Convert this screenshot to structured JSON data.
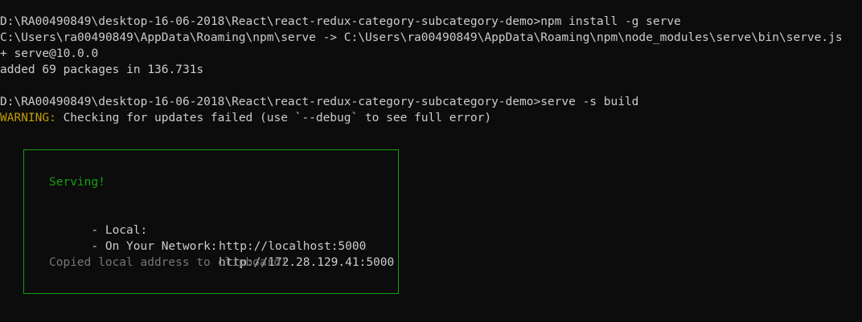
{
  "terminal": {
    "lines": [
      "D:\\RA00490849\\desktop-16-06-2018\\React\\react-redux-category-subcategory-demo>npm install -g serve",
      "C:\\Users\\ra00490849\\AppData\\Roaming\\npm\\serve -> C:\\Users\\ra00490849\\AppData\\Roaming\\npm\\node_modules\\serve\\bin\\serve.js",
      "+ serve@10.0.0",
      "added 69 packages in 136.731s",
      "D:\\RA00490849\\desktop-16-06-2018\\React\\react-redux-category-subcategory-demo>serve -s build"
    ],
    "warning_label": "WARNING:",
    "warning_text": " Checking for updates failed (use `--debug` to see full error)"
  },
  "serve_box": {
    "title": "Serving!",
    "local_label": "- Local:",
    "local_url": "http://localhost:5000",
    "network_label": "- On Your Network:",
    "network_url": "http://172.28.129.41:5000",
    "copied_text": "Copied local address to clipboard!"
  },
  "colors": {
    "background": "#0c0c0c",
    "foreground": "#cccccc",
    "warning": "#c19c00",
    "success": "#13a10e",
    "muted": "#767676"
  }
}
